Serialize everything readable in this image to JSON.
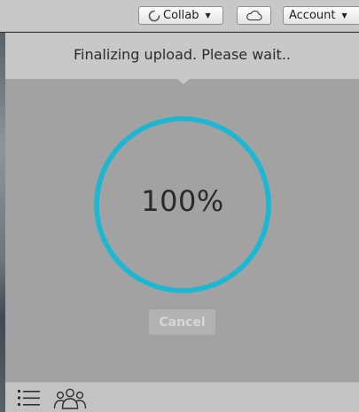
{
  "toolbar": {
    "collab_label": "Collab",
    "account_label": "Account",
    "icons": [
      "loading-spinner-icon",
      "chevron-down-icon",
      "cloud-icon"
    ]
  },
  "upload": {
    "status_text": "Finalizing upload. Please wait..",
    "progress_text": "100%",
    "progress": 1.0,
    "cancel_label": "Cancel"
  },
  "footer": {
    "icons": [
      "list-icon",
      "people-icon"
    ]
  },
  "colors": {
    "accent": "#1ab8d2",
    "panel_bg": "#a2a2a2",
    "header_bg": "#c8c8c8",
    "footer_bg": "#c3c3c3"
  }
}
